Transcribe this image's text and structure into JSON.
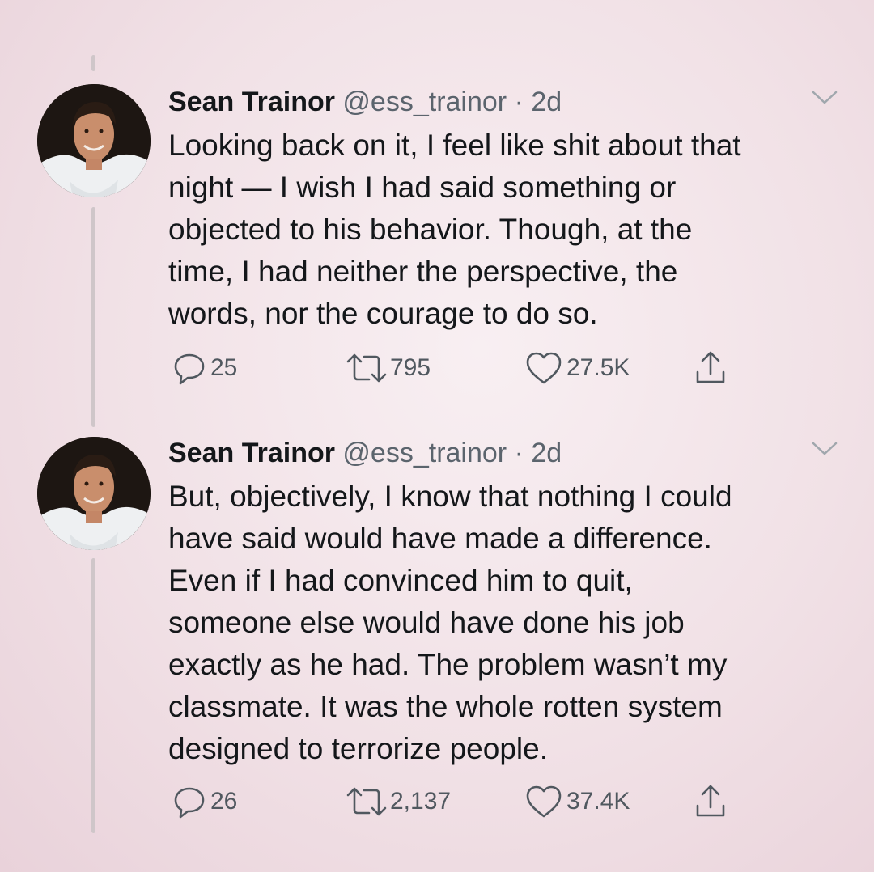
{
  "tweets": [
    {
      "author_name": "Sean Trainor",
      "handle": "@ess_trainor",
      "separator": "·",
      "time": "2d",
      "text": "Looking back on it, I feel like shit about that\nnight — I wish I had said something or\nobjected to his behavior. Though, at the\ntime, I had neither the perspective, the\nwords, nor the courage to do so.",
      "replies": "25",
      "retweets": "795",
      "likes": "27.5K",
      "icons": {
        "avatar": "avatar",
        "menu": "chevron-down-icon",
        "reply": "reply-icon",
        "retweet": "retweet-icon",
        "like": "heart-icon",
        "share": "share-icon"
      }
    },
    {
      "author_name": "Sean Trainor",
      "handle": "@ess_trainor",
      "separator": "·",
      "time": "2d",
      "text": "But, objectively, I know that nothing I could\nhave said would have made a difference.\nEven if I had convinced him to quit,\nsomeone else would have done his job\nexactly as he had. The problem wasn’t my\nclassmate. It was the whole rotten system\ndesigned to terrorize people.",
      "replies": "26",
      "retweets": "2,137",
      "likes": "37.4K",
      "icons": {
        "avatar": "avatar",
        "menu": "chevron-down-icon",
        "reply": "reply-icon",
        "retweet": "retweet-icon",
        "like": "heart-icon",
        "share": "share-icon"
      }
    }
  ],
  "colors": {
    "background": "#f2e4e9",
    "text": "#14171a",
    "secondary_text": "#5b646d",
    "thread_line": "#cfc6c9"
  }
}
